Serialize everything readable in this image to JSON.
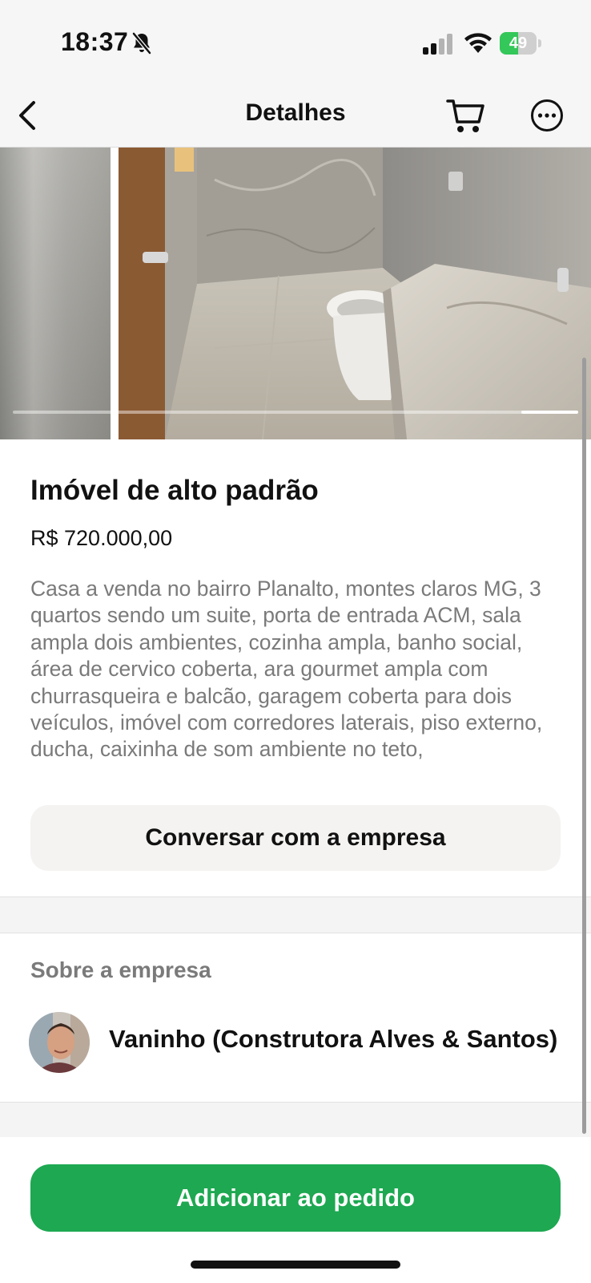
{
  "status_bar": {
    "time": "18:37",
    "battery_level": "49",
    "battery_fraction": 0.49,
    "accent_green": "#34c759",
    "icons": [
      "bell-off-icon",
      "signal-icon",
      "wifi-icon",
      "battery-icon"
    ]
  },
  "nav": {
    "title": "Detalhes",
    "icons": [
      "chevron-left-icon",
      "cart-icon",
      "more-icon"
    ]
  },
  "gallery": {
    "progress_fraction": 0.1,
    "progress_position": 0.9
  },
  "product": {
    "title": "Imóvel de alto padrão",
    "price": "R$ 720.000,00",
    "description": "Casa a venda no bairro Planalto, montes claros MG, 3 quartos sendo um suite, porta de entrada  ACM, sala ampla dois ambientes, cozinha ampla, banho social, área de cervico coberta, ara gourmet  ampla com churrasqueira e balcão, garagem coberta para dois veículos, imóvel com corredores laterais, piso externo, ducha,  caixinha de som ambiente no teto,"
  },
  "actions": {
    "chat_label": "Conversar com a empresa",
    "add_label": "Adicionar ao pedido",
    "add_color": "#1da851"
  },
  "company": {
    "section_label": "Sobre a empresa",
    "name": "Vaninho (Construtora Alves & Santos)"
  }
}
